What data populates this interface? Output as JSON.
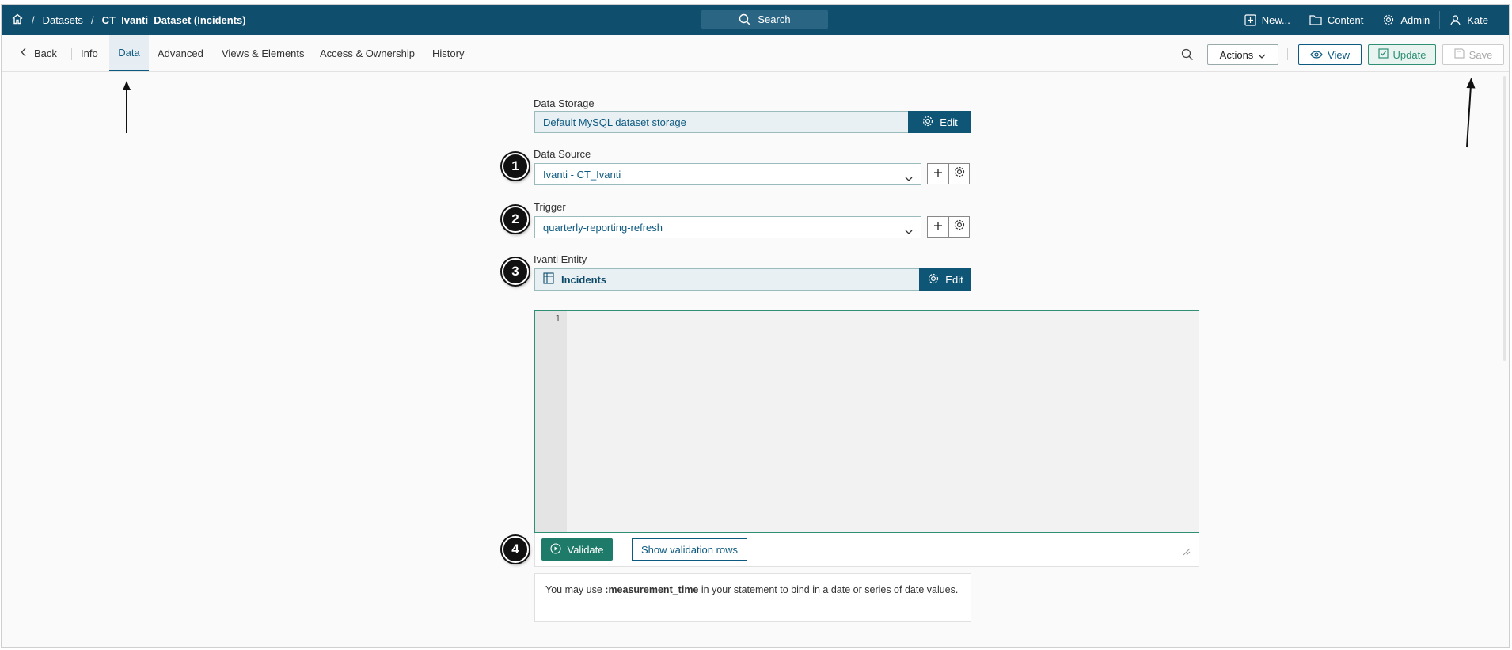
{
  "breadcrumbs": {
    "home_icon": "home-icon",
    "datasets": "Datasets",
    "current": "CT_Ivanti_Dataset (Incidents)"
  },
  "search": {
    "label": "Search"
  },
  "top_menu": {
    "new": "New...",
    "content": "Content",
    "admin": "Admin",
    "user": "Kate"
  },
  "tabs": {
    "back": "Back",
    "info": "Info",
    "data": "Data",
    "advanced": "Advanced",
    "views": "Views & Elements",
    "access": "Access & Ownership",
    "history": "History"
  },
  "toolbar": {
    "actions": "Actions",
    "view": "View",
    "update": "Update",
    "save": "Save"
  },
  "data_storage": {
    "label": "Data Storage",
    "value": "Default MySQL dataset storage",
    "edit": "Edit"
  },
  "data_source": {
    "label": "Data Source",
    "value": "Ivanti - CT_Ivanti"
  },
  "trigger": {
    "label": "Trigger",
    "value": "quarterly-reporting-refresh"
  },
  "entity": {
    "label": "Ivanti Entity",
    "value": "Incidents",
    "edit": "Edit"
  },
  "editor": {
    "line_number": "1"
  },
  "validate": {
    "validate": "Validate",
    "show_rows": "Show validation rows"
  },
  "note": {
    "prefix": "You may use ",
    "param": ":measurement_time",
    "suffix": " in your statement to bind in a date or series of date values."
  },
  "badges": [
    "1",
    "2",
    "3",
    "4"
  ],
  "colors": {
    "topbar": "#104e6e",
    "accent": "#0f5576",
    "validate": "#1e7b6a"
  }
}
